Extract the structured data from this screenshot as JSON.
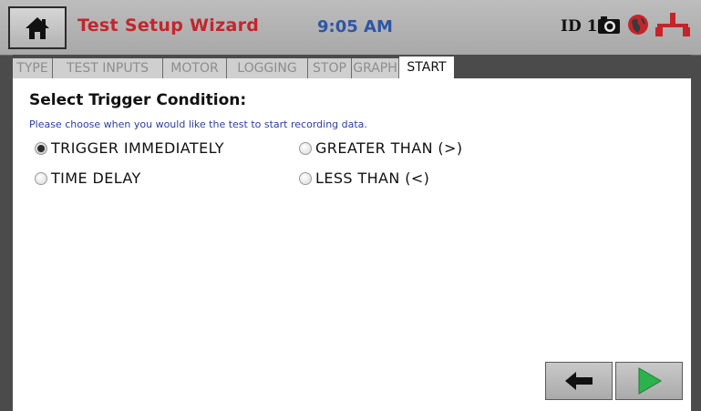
{
  "header": {
    "title": "Test Setup Wizard",
    "time": "9:05 AM",
    "id_label": "ID 1",
    "icons": [
      "home-icon",
      "camera-icon",
      "globe-icon",
      "network-icon"
    ]
  },
  "tabs": [
    {
      "label": "TYPE",
      "active": false
    },
    {
      "label": "TEST INPUTS",
      "active": false
    },
    {
      "label": "MOTOR",
      "active": false
    },
    {
      "label": "LOGGING",
      "active": false
    },
    {
      "label": "STOP",
      "active": false
    },
    {
      "label": "GRAPH",
      "active": false
    },
    {
      "label": "START",
      "active": true
    }
  ],
  "trigger": {
    "title": "Select Trigger Condition:",
    "hint": "Please choose when you would like the test to start recording data.",
    "options": [
      {
        "label": "TRIGGER IMMEDIATELY",
        "selected": true
      },
      {
        "label": "GREATER THAN (>)",
        "selected": false
      },
      {
        "label": "TIME DELAY",
        "selected": false
      },
      {
        "label": "LESS THAN (<)",
        "selected": false
      }
    ]
  },
  "nav": {
    "back": "back-arrow-icon",
    "next": "next-play-icon"
  },
  "colors": {
    "title_red": "#c4252b",
    "clock_blue": "#2f55a4",
    "next_green": "#2bb24c"
  }
}
